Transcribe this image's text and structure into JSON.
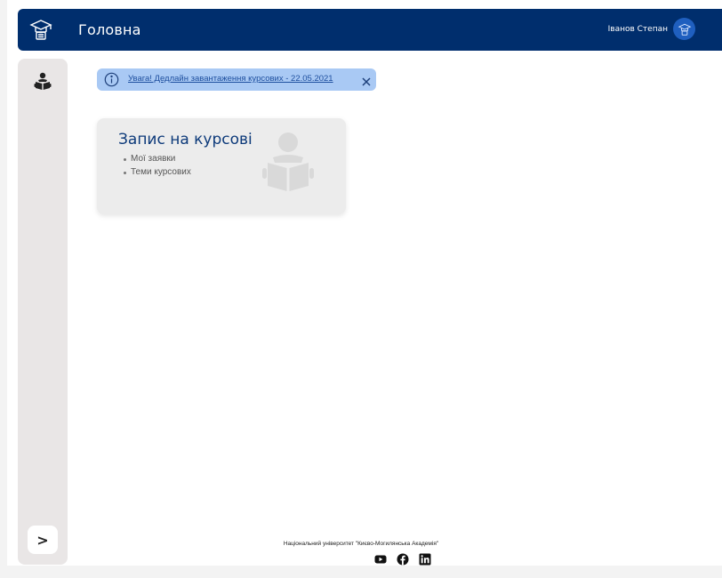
{
  "header": {
    "title": "Головна",
    "user_name": "Іванов Степан",
    "brand_color": "#002e6d"
  },
  "sidebar": {
    "items": [
      {
        "icon": "reader-icon"
      }
    ],
    "expand_label": ">"
  },
  "alert": {
    "text": "Увага! Дедлайн завантаження курсових - 22.05.2021",
    "background": "#a9c9f4"
  },
  "card": {
    "title": "Запис на курсові",
    "links": [
      "Мої заявки",
      "Теми курсових"
    ]
  },
  "footer": {
    "text": "Національний університет \"Києво-Могилянська Академія\"",
    "socials": [
      "youtube-icon",
      "facebook-icon",
      "linkedin-icon"
    ]
  }
}
